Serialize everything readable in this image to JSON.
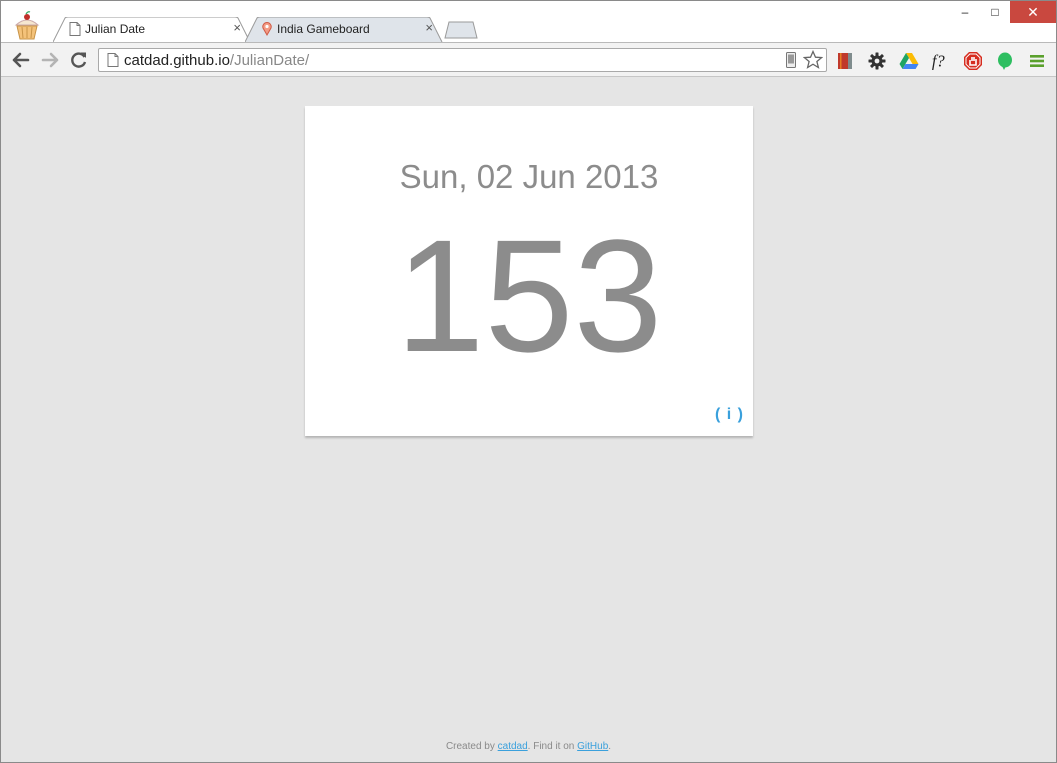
{
  "browser": {
    "tabs": [
      {
        "label": "Julian Date",
        "active": true
      },
      {
        "label": "India Gameboard",
        "active": false
      }
    ],
    "close_glyph": "×",
    "window_controls": {
      "minimize": "–",
      "maximize": "□",
      "close": "✕"
    },
    "address": {
      "host": "catdad.github.io",
      "path": "/JulianDate/"
    },
    "colors": {
      "close_button": "#c9483f",
      "accent_link": "#3aa0dc"
    }
  },
  "card": {
    "date": "Sun, 02 Jun 2013",
    "day_of_year": "153",
    "info_label": "( i )"
  },
  "footer": {
    "prefix": "Created by ",
    "author_link": "catdad",
    "middle": ". Find it on ",
    "github_link": "GitHub",
    "suffix": "."
  },
  "icons": {
    "app": "cupcake-icon",
    "tab1": "page-icon",
    "tab2": "map-pin-icon",
    "toolbar": [
      "back-icon",
      "forward-icon",
      "reload-icon"
    ],
    "omnibox": [
      "page-icon",
      "mobile-icon",
      "star-icon"
    ],
    "extensions": [
      "book-icon",
      "gear-icon",
      "google-drive-icon",
      "font-finder-icon",
      "adblock-icon",
      "evernote-icon",
      "menu-icon"
    ]
  }
}
